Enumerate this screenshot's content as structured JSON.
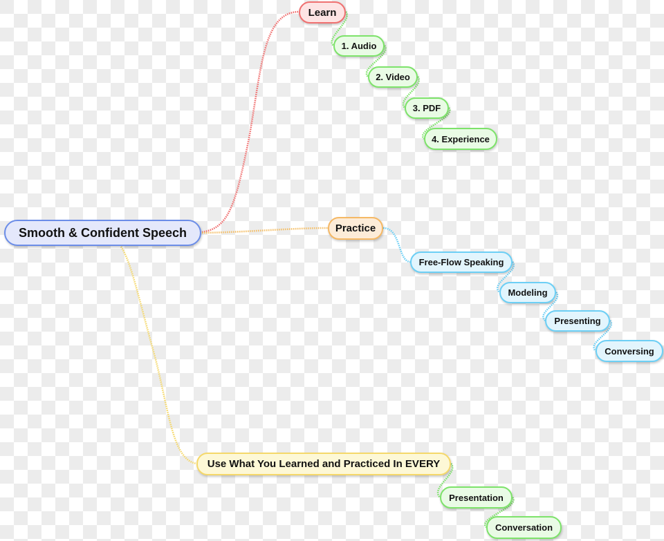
{
  "mindmap": {
    "root": {
      "label": "Smooth & Confident Speech"
    },
    "branches": [
      {
        "label": "Learn",
        "color": "#f07070",
        "children": [
          {
            "label": "1. Audio"
          },
          {
            "label": "2. Video"
          },
          {
            "label": "3. PDF"
          },
          {
            "label": "4. Experience"
          }
        ],
        "child_color": "#7de36a"
      },
      {
        "label": "Practice",
        "color": "#f5b864",
        "children": [
          {
            "label": "Free-Flow Speaking"
          },
          {
            "label": "Modeling"
          },
          {
            "label": "Presenting"
          },
          {
            "label": "Conversing"
          }
        ],
        "child_color": "#6ccff5"
      },
      {
        "label": "Use What You Learned and Practiced In EVERY",
        "color": "#f5d86a",
        "children": [
          {
            "label": "Presentation"
          },
          {
            "label": "Conversation"
          }
        ],
        "child_color": "#7de36a"
      }
    ]
  }
}
